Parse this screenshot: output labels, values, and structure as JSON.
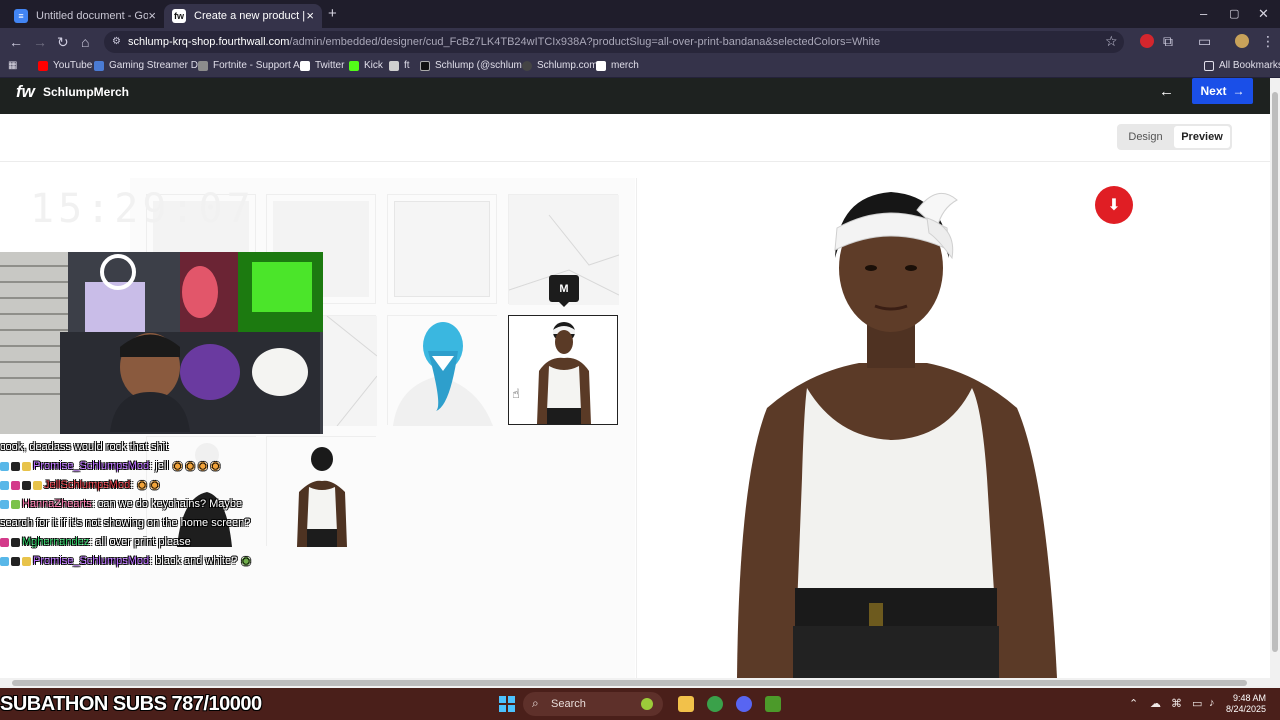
{
  "browser": {
    "tabs": [
      {
        "title": "Untitled document - Google Docs",
        "icon": "docs-icon"
      },
      {
        "title": "Create a new product | Fourthwall",
        "icon": "fourthwall-icon"
      }
    ],
    "new_tab": "+",
    "url_host": "schlump-krq-shop.fourthwall.com",
    "url_rest": "/admin/embedded/designer/cud_FcBz7LK4TB24wITCIx938A?productSlug=all-over-print-bandana&selectedColors=White",
    "bookmarks": [
      {
        "label": "YouTube",
        "color": "#ff0000"
      },
      {
        "label": "Gaming Streamer D...",
        "color": "#4a7bd4"
      },
      {
        "label": "Fortnite - Support A...",
        "color": "#8c8c8c"
      },
      {
        "label": "Twitter",
        "color": "#ffffff"
      },
      {
        "label": "Kick",
        "color": "#53fc18"
      },
      {
        "label": "ft",
        "color": "#cfcfcf"
      },
      {
        "label": "Schlump (@schlum...",
        "color": "#111111"
      },
      {
        "label": "Schlump.com",
        "color": "#444444"
      },
      {
        "label": "merch",
        "color": "#ffffff"
      }
    ],
    "all_bookmarks": "All Bookmarks"
  },
  "app": {
    "logo": "fw",
    "store_name": "SchlumpMerch",
    "next_label": "Next",
    "design_label": "Design",
    "preview_label": "Preview"
  },
  "grid": {
    "tooltip": "M"
  },
  "overlay": {
    "clock": "15:29:07",
    "chat": [
      {
        "user": "",
        "text": "cook, deadass would rock that shit",
        "user_class": ""
      },
      {
        "user": "Promise_SchlumpsMod",
        "text": ": jell",
        "user_class": "user-purple"
      },
      {
        "user": "JellSchlumpsMod",
        "text": ":",
        "user_class": "user-red"
      },
      {
        "user": "HannaZhearts",
        "text": ": can we do keychains? Maybe",
        "user_class": "user-pink"
      },
      {
        "user": "",
        "text": "search for it if it's not showing on the home screen?",
        "user_class": ""
      },
      {
        "user": "Mghernandez",
        "text": ": all over print please",
        "user_class": "user-green"
      },
      {
        "user": "Promise_SchlumpsMod",
        "text": ": black and white?",
        "user_class": "user-purple"
      }
    ],
    "subathon": "SUBATHON SUBS 787/10000"
  },
  "taskbar": {
    "search": "Search",
    "time": "9:48 AM",
    "date": "8/24/2025"
  },
  "colors": {
    "accent_blue": "#1a4fe8",
    "download_red": "#e01e24",
    "header_dark": "#1e2220"
  }
}
